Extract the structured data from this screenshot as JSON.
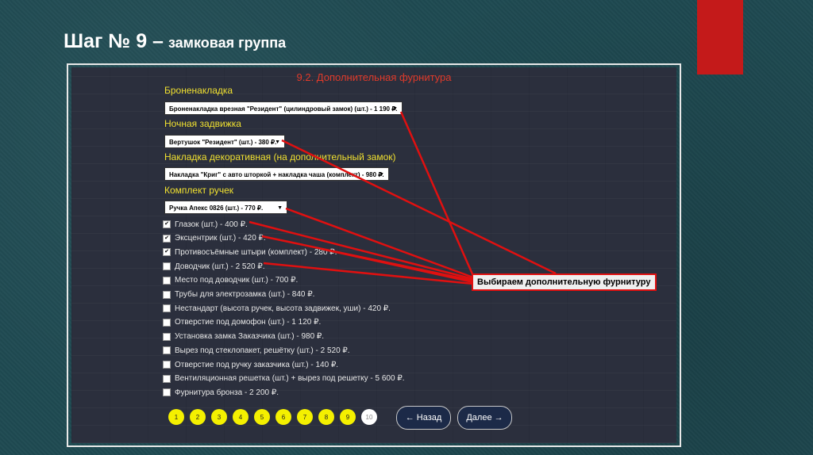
{
  "slide": {
    "title_main": "Шаг № 9 –",
    "title_sub": "замковая группа",
    "accent_color": "#c41a1a"
  },
  "panel": {
    "title": "9.2. Дополнительная фурнитура",
    "sections": [
      {
        "label": "Броненакладка",
        "select": "Броненакладка врезная \"Резидент\" (цилиндровый замок) (шт.) - 1 190 ₽."
      },
      {
        "label": "Ночная задвижка",
        "select": "Вертушок \"Резидент\" (шт.) - 380 ₽."
      },
      {
        "label": "Накладка декоративная (на дополнительный замок)",
        "select": "Накладка \"Криг\" с авто шторкой + накладка чаша (комплект) - 980 ₽."
      },
      {
        "label": "Комплект ручек",
        "select": "Ручка Апекс 0826 (шт.) - 770 ₽."
      }
    ],
    "options": [
      {
        "label": "Глазок (шт.) - 400 ₽.",
        "checked": true
      },
      {
        "label": "Эксцентрик (шт.) - 420 ₽.",
        "checked": true
      },
      {
        "label": "Противосъёмные штыри (комплект) - 280 ₽.",
        "checked": true
      },
      {
        "label": "Доводчик (шт.) - 2 520 ₽.",
        "checked": false
      },
      {
        "label": "Место под доводчик (шт.) - 700 ₽.",
        "checked": false
      },
      {
        "label": "Трубы для электрозамка (шт.) - 840 ₽.",
        "checked": false
      },
      {
        "label": "Нестандарт (высота ручек, высота задвижек, уши) - 420 ₽.",
        "checked": false
      },
      {
        "label": "Отверстие под домофон (шт.) - 1 120 ₽.",
        "checked": false
      },
      {
        "label": "Установка замка Заказчика (шт.) - 980 ₽.",
        "checked": false
      },
      {
        "label": "Вырез под стеклопакет, решётку (шт.) - 2 520 ₽.",
        "checked": false
      },
      {
        "label": "Отверстие под ручку заказчика (шт.) - 140 ₽.",
        "checked": false
      },
      {
        "label": "Вентиляционная решетка (шт.) + вырез под решетку - 5 600 ₽.",
        "checked": false
      },
      {
        "label": "Фурнитура бронза - 2 200 ₽.",
        "checked": false
      }
    ],
    "pages": [
      "1",
      "2",
      "3",
      "4",
      "5",
      "6",
      "7",
      "8",
      "9",
      "10"
    ],
    "current_page": "10",
    "back_label": "← Назад",
    "next_label": "Далее →"
  },
  "callout": {
    "text": "Выбираем дополнительную фурнитуру",
    "color": "#e01010"
  }
}
